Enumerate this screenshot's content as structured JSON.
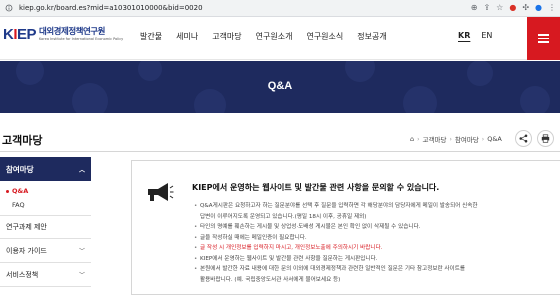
{
  "browser": {
    "url": "kiep.go.kr/board.es?mid=a10301010000&bid=0020",
    "icons": [
      "zoom-icon",
      "share-icon",
      "star-icon",
      "extension-icon",
      "menu-icon"
    ]
  },
  "header": {
    "logo_mark": "KIEP",
    "logo_kr": "대외경제정책연구원",
    "logo_en": "Korea Institute for International Economic Policy",
    "nav": [
      "발간물",
      "세미나",
      "고객마당",
      "연구원소개",
      "연구원소식",
      "정보공개"
    ],
    "lang": {
      "kr": "KR",
      "en": "EN"
    }
  },
  "banner": {
    "title": "Q&A"
  },
  "section": {
    "title": "고객마당",
    "breadcrumb": [
      "고객마당",
      "참여마당",
      "Q&A"
    ]
  },
  "lnb": {
    "head": "참여마당",
    "sub": [
      "Q&A",
      "FAQ"
    ],
    "groups": [
      "연구과제 제안",
      "이용자 가이드",
      "서비스정책"
    ]
  },
  "notice": {
    "heading": "KIEP에서 운영하는 웹사이트 및 발간물 관련 사항을 문의할 수 있습니다.",
    "items": [
      {
        "line1": "Q&A게시판은 요청하고자 하는 질문분야를 선택 후 질문을 입력하면 각 해당분야의 담당자에게 메일이 발송되어 신속한",
        "line2": "답변이 이루어지도록 운영되고 있습니다.(평일 18시 이후, 공휴일 제외)"
      },
      {
        "line1": "타인의 명예를 훼손하는 게시물 및 상업성·도배성 게시물은 본인 확인 없이 삭제될 수 있습니다."
      },
      {
        "line1": "글을 작성하실 때에는 메일인증이 필요합니다."
      },
      {
        "line1": "글 작성 시 개인정보를 입력하지 마시고, 개인정보노출에 주의하시기 바랍니다.",
        "warn": true
      },
      {
        "line1": "KIEP에서 운영하는 웹사이트 및 발간물 관련 사항을 질문하는 게시판입니다."
      },
      {
        "line1": "본원에서 발간한 자료 내용에 대한 문의 이외에 대외경제정책과 관련한 일반적인 질문은 기타 참고정보란 사이트를",
        "line2": "활용바랍니다. (예. 국립중앙도서관 사서에게 물어보세요 등)"
      }
    ]
  },
  "colors": {
    "navy": "#1e2a5e",
    "red": "#d71920"
  }
}
